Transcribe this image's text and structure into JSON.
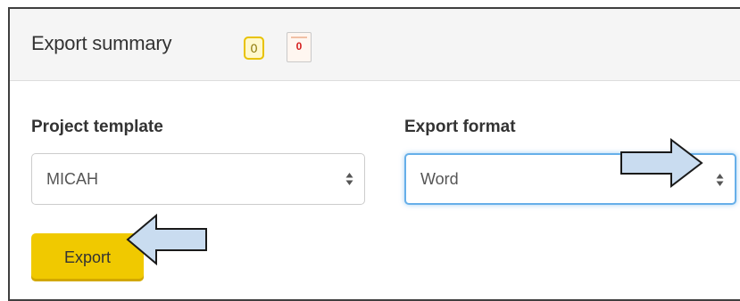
{
  "header": {
    "title": "Export summary",
    "badge_count": "0",
    "pdf_count": "0"
  },
  "project_template": {
    "label": "Project template",
    "selected": "MICAH"
  },
  "export_format": {
    "label": "Export format",
    "selected": "Word"
  },
  "export_button": {
    "label": "Export"
  },
  "colors": {
    "accent_yellow": "#f0c900",
    "focus_blue": "#66afe9",
    "arrow_fill": "#c9dcf0"
  },
  "icons": [
    "pdf-icon",
    "select-updown-icon",
    "callout-arrow-right",
    "callout-arrow-left"
  ]
}
